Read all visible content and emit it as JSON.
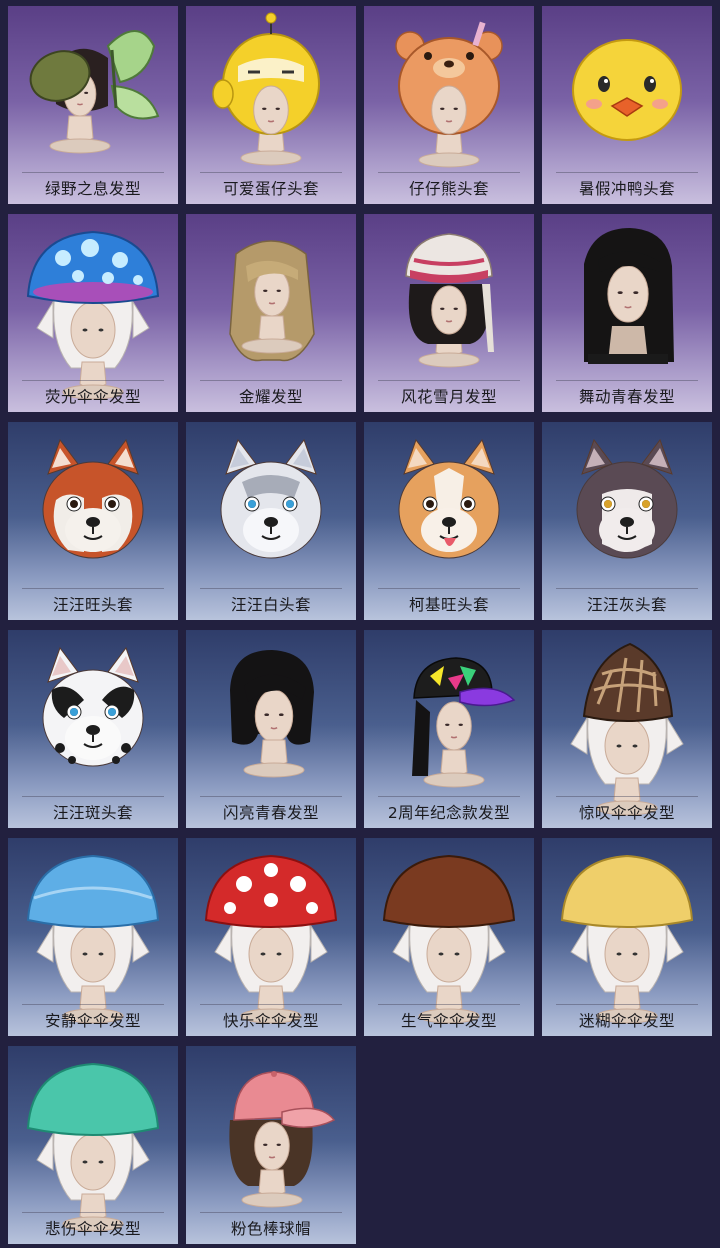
{
  "colors": {
    "page_background": "#22203f",
    "card_purple": "#7a62a6",
    "card_blue": "#4a5f8e",
    "label_text": "#1a1a1e"
  },
  "items": [
    {
      "name": "绿野之息发型",
      "theme": "purple",
      "art": "butterfly-hair"
    },
    {
      "name": "可爱蛋仔头套",
      "theme": "purple",
      "art": "yellow-egg-hood"
    },
    {
      "name": "仔仔熊头套",
      "theme": "purple",
      "art": "bear-hood"
    },
    {
      "name": "暑假冲鸭头套",
      "theme": "purple",
      "art": "duck-head"
    },
    {
      "name": "荧光伞伞发型",
      "theme": "purple",
      "art": "glow-mushroom"
    },
    {
      "name": "金耀发型",
      "theme": "purple",
      "art": "golden-long-hair"
    },
    {
      "name": "风花雪月发型",
      "theme": "purple",
      "art": "ethnic-headdress"
    },
    {
      "name": "舞动青春发型",
      "theme": "purple",
      "art": "black-long-hair"
    },
    {
      "name": "汪汪旺头套",
      "theme": "blue",
      "art": "shiba-head"
    },
    {
      "name": "汪汪白头套",
      "theme": "blue",
      "art": "white-husky-head"
    },
    {
      "name": "柯基旺头套",
      "theme": "blue",
      "art": "corgi-head"
    },
    {
      "name": "汪汪灰头套",
      "theme": "blue",
      "art": "gray-husky-head"
    },
    {
      "name": "汪汪斑头套",
      "theme": "blue",
      "art": "dalmatian-head"
    },
    {
      "name": "闪亮青春发型",
      "theme": "blue",
      "art": "black-bob-hair"
    },
    {
      "name": "2周年纪念款发型",
      "theme": "blue",
      "art": "anniversary-cap"
    },
    {
      "name": "惊叹伞伞发型",
      "theme": "blue",
      "art": "morel-mushroom"
    },
    {
      "name": "安静伞伞发型",
      "theme": "blue",
      "art": "blue-mushroom"
    },
    {
      "name": "快乐伞伞发型",
      "theme": "blue",
      "art": "red-spotted-mushroom"
    },
    {
      "name": "生气伞伞发型",
      "theme": "blue",
      "art": "brown-mushroom"
    },
    {
      "name": "迷糊伞伞发型",
      "theme": "blue",
      "art": "yellow-mushroom"
    },
    {
      "name": "悲伤伞伞发型",
      "theme": "blue",
      "art": "teal-mushroom"
    },
    {
      "name": "粉色棒球帽",
      "theme": "blue",
      "art": "pink-baseball-cap"
    }
  ]
}
